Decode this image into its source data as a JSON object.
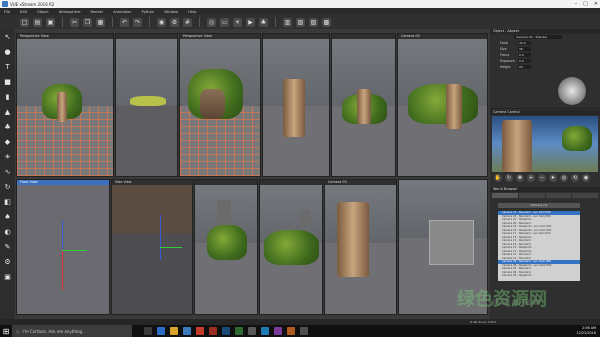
{
  "window": {
    "title": "VUE xStream 2016 R2"
  },
  "menu": [
    "File",
    "Edit",
    "Object",
    "Atmosphere",
    "Render",
    "Animation",
    "Python",
    "Window",
    "Help"
  ],
  "toolbar": {
    "icons": [
      "new-icon",
      "open-icon",
      "save-icon",
      "cut-icon",
      "copy-icon",
      "paste-icon",
      "undo-icon",
      "redo-icon",
      "render-icon",
      "settings-icon",
      "grid-icon",
      "globe-icon",
      "camera-icon",
      "light-icon",
      "play-icon",
      "ecosystem-icon"
    ]
  },
  "lefttools": [
    "select-tool",
    "sphere-tool",
    "text-tool",
    "cube-tool",
    "cylinder-tool",
    "terrain-tool",
    "plant-tool",
    "rock-tool",
    "light-tool",
    "paint-tool",
    "rotate-tool",
    "camera-tool",
    "grass-tool",
    "eraser-tool",
    "brush-tool",
    "gear-tool",
    "grid-tool"
  ],
  "viewports": {
    "top": [
      {
        "label": "Perspective View"
      },
      {
        "label": ""
      },
      {
        "label": "Perspective View"
      },
      {
        "label": ""
      },
      {
        "label": ""
      },
      {
        "label": "Camera 09"
      }
    ],
    "bottom": [
      {
        "label": "Front View",
        "active": true
      },
      {
        "label": "Side View"
      },
      {
        "label": ""
      },
      {
        "label": ""
      },
      {
        "label": "Camera 03"
      }
    ]
  },
  "object_panel": {
    "title": "Object - Aspect",
    "camera": "Camera 20 - Standar",
    "props": [
      {
        "k": "Focal",
        "v": "30.0"
      },
      {
        "k": "Size",
        "v": "36"
      },
      {
        "k": "Focus",
        "v": "0.0"
      },
      {
        "k": "Exposure",
        "v": "0.0"
      },
      {
        "k": "Height",
        "v": "20"
      }
    ]
  },
  "camera_control": {
    "title": "Camera Control"
  },
  "world_browser": {
    "title": "World Browser",
    "tabs": [
      "",
      "",
      "",
      ""
    ],
    "header": "Camera (3)",
    "rows": [
      "Camera 23 - Standard - sun Cam 050",
      "Camera 22 - Standard - sun Cam 050",
      "Camera 21 - Telephoto",
      "Camera 20 - Standard",
      "Camera 19 - Telephoto - sun Cam 024",
      "Camera 18 - Telephoto - sun Cam 035",
      "Camera 17 - Standard - sun Cam 013",
      "Camera 16 - Telephoto",
      "Camera 15 - Standard",
      "Camera 14 - Standard",
      "Camera 13 - Telephoto",
      "Camera 12 - Telephoto",
      "Camera 11 - Standard",
      "Camera 10 - Standard",
      "Camera 09 - Standard - sun View 208",
      "Camera 08 - Telephoto - sun View 050",
      "Camera 07 - Standard",
      "Camera 06 - Standard",
      "Camera 05 - Telephoto"
    ],
    "selected": [
      0,
      14
    ]
  },
  "statusbar": {
    "text": "8 GB  Zoom 100%"
  },
  "taskbar": {
    "cortana": "I'm Cortana. Ask me anything.",
    "apps": [
      {
        "name": "task-view-icon",
        "color": "#3a3a3a"
      },
      {
        "name": "edge-icon",
        "color": "#2b6cc4"
      },
      {
        "name": "explorer-icon",
        "color": "#d8a52a"
      },
      {
        "name": "store-icon",
        "color": "#3c7ac0"
      },
      {
        "name": "vue-icon",
        "color": "#c33c2c"
      },
      {
        "name": "vue-icon-2",
        "color": "#9b2d22"
      },
      {
        "name": "photoshop-icon",
        "color": "#1b4a7a"
      },
      {
        "name": "app-icon-1",
        "color": "#2d6a2f"
      },
      {
        "name": "app-icon-2",
        "color": "#585858"
      },
      {
        "name": "app-icon-3",
        "color": "#1f7bb5"
      },
      {
        "name": "app-icon-4",
        "color": "#7a3a9a"
      },
      {
        "name": "app-icon-5",
        "color": "#b05a1d"
      },
      {
        "name": "app-icon-6",
        "color": "#4f4f4f"
      }
    ],
    "time": "2:56 AM",
    "date": "12/22/2016"
  },
  "watermark": "绿色资源网"
}
